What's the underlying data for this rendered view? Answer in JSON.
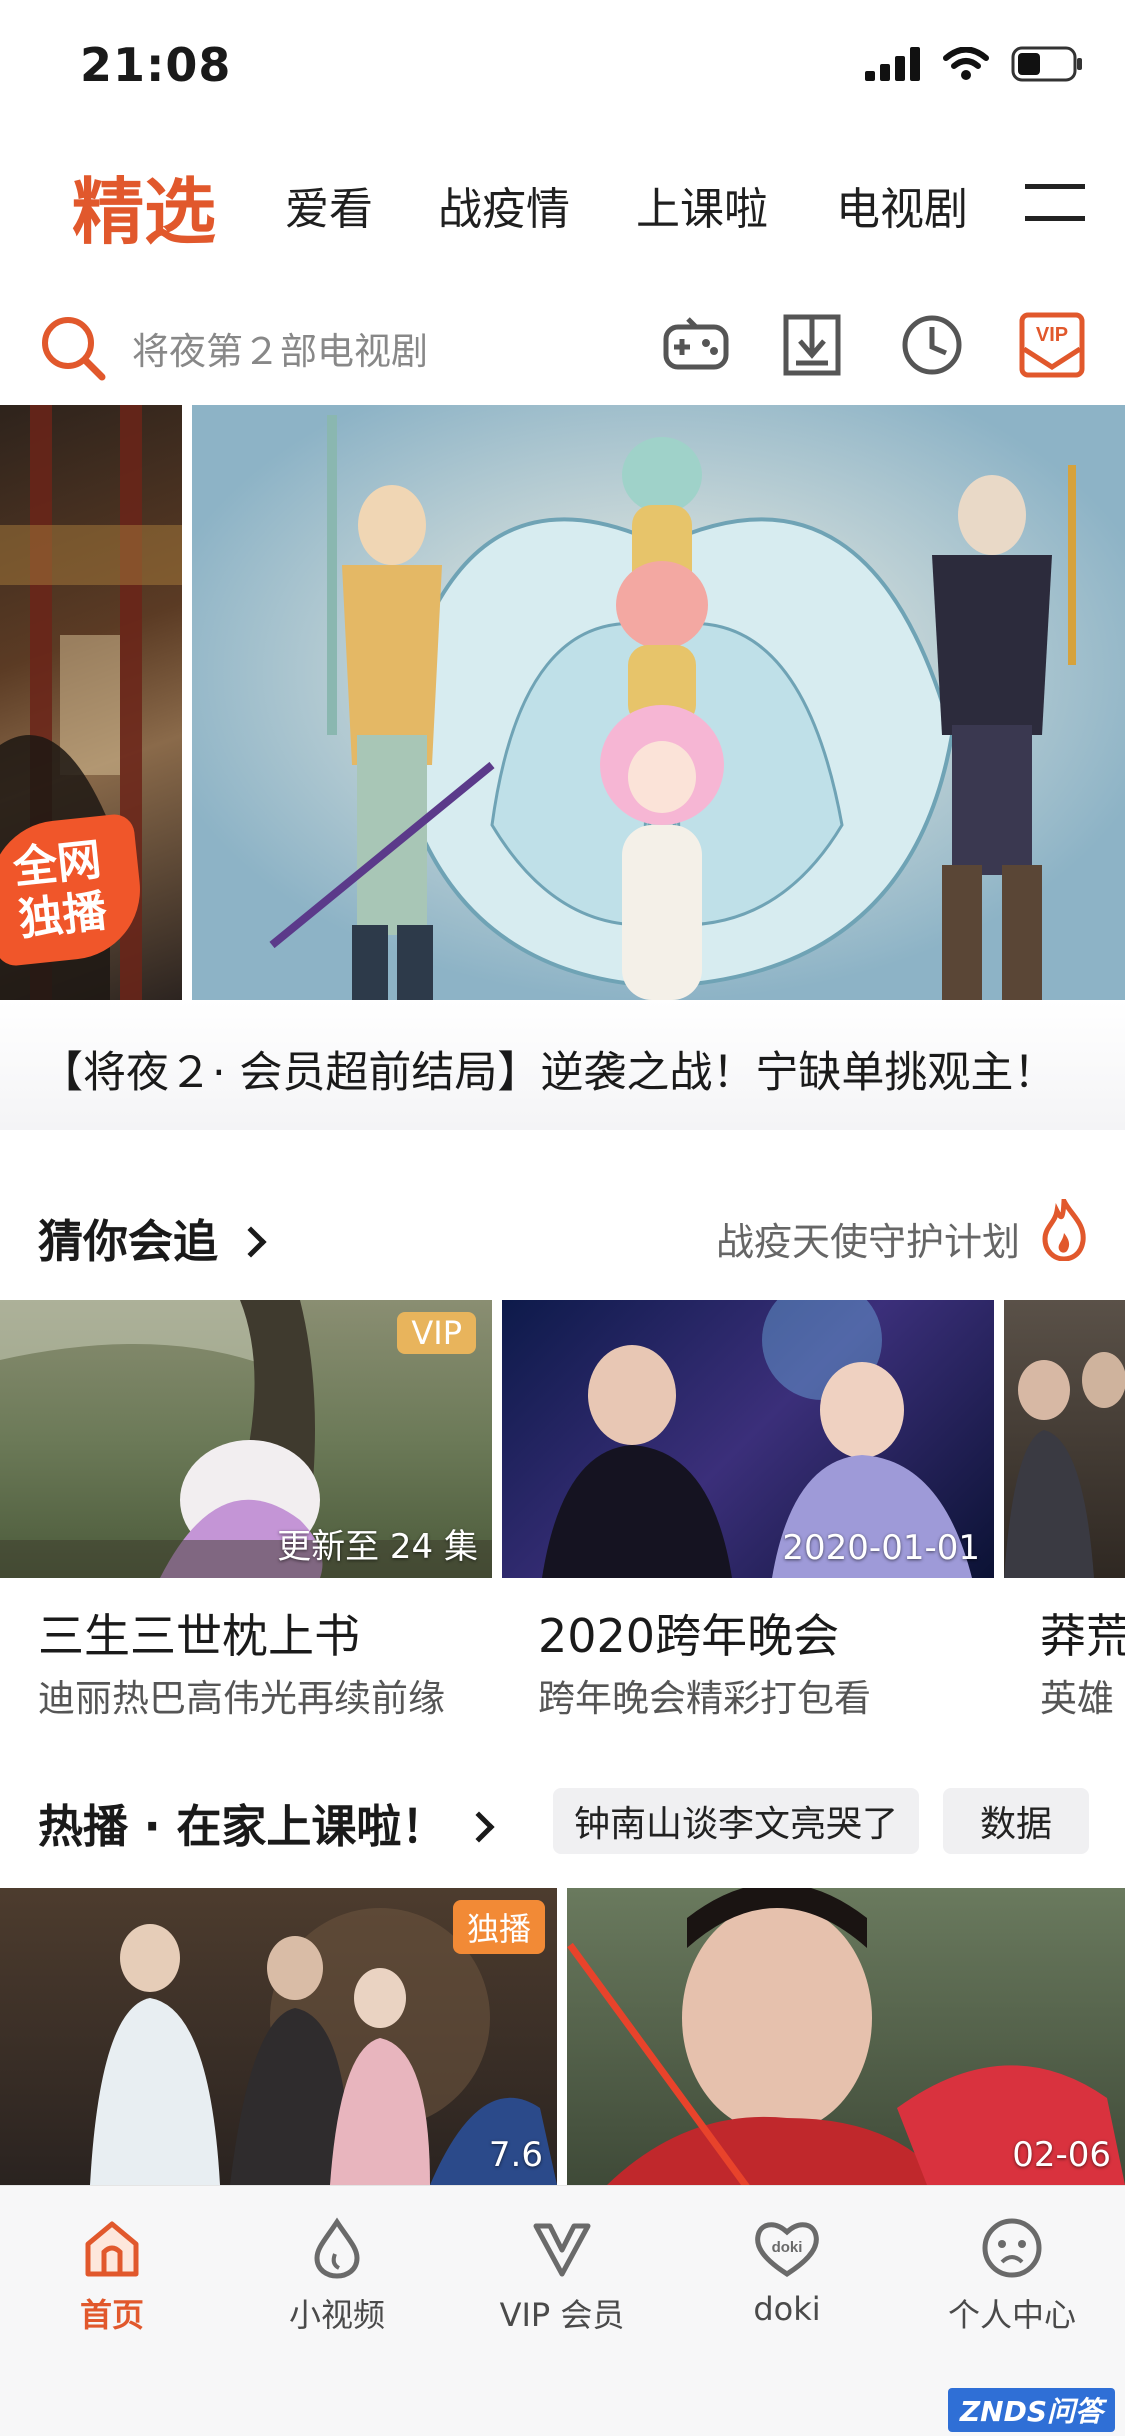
{
  "status_bar": {
    "time": "21:08"
  },
  "top_nav": {
    "tabs": [
      {
        "label": "精选",
        "active": true
      },
      {
        "label": "爱看",
        "active": false
      },
      {
        "label": "战疫情",
        "active": false
      },
      {
        "label": "上课啦",
        "active": false
      },
      {
        "label": "电视剧",
        "active": false
      }
    ]
  },
  "search": {
    "placeholder": "将夜第２部电视剧"
  },
  "banner": {
    "left_badge": "全网独播",
    "caption": "【将夜２· 会员超前结局】逆袭之战！宁缺单挑观主！"
  },
  "section_recommend": {
    "title": "猜你会追",
    "link": "战疫天使守护计划",
    "cards": [
      {
        "title": "三生三世枕上书",
        "subtitle": "迪丽热巴高伟光再续前缘",
        "badge": "VIP",
        "overlay": "更新至 24 集"
      },
      {
        "title": "2020跨年晚会",
        "subtitle": "跨年晚会精彩打包看",
        "badge": "",
        "overlay": "2020-01-01"
      },
      {
        "title": "莽荒",
        "subtitle": "英雄",
        "badge": "",
        "overlay": ""
      }
    ]
  },
  "section_hot": {
    "title": "热播 · 在家上课啦！",
    "tags": [
      "钟南山谈李文亮哭了",
      "数据"
    ],
    "cards": [
      {
        "badge": "独播",
        "overlay": "7.6"
      },
      {
        "badge": "",
        "overlay": "02-06"
      }
    ]
  },
  "tabbar": {
    "items": [
      {
        "label": "首页",
        "icon": "home-icon",
        "active": true
      },
      {
        "label": "小视频",
        "icon": "drop-icon",
        "active": false
      },
      {
        "label": "VIP 会员",
        "icon": "vip-crown-icon",
        "active": false
      },
      {
        "label": "doki",
        "icon": "doki-heart-icon",
        "active": false
      },
      {
        "label": "个人中心",
        "icon": "profile-icon",
        "active": false
      }
    ]
  },
  "watermark": "ZNDS问答",
  "colors": {
    "accent": "#e1582c",
    "vip": "#e8b45c",
    "annotation_arrow": "#e8432b"
  }
}
